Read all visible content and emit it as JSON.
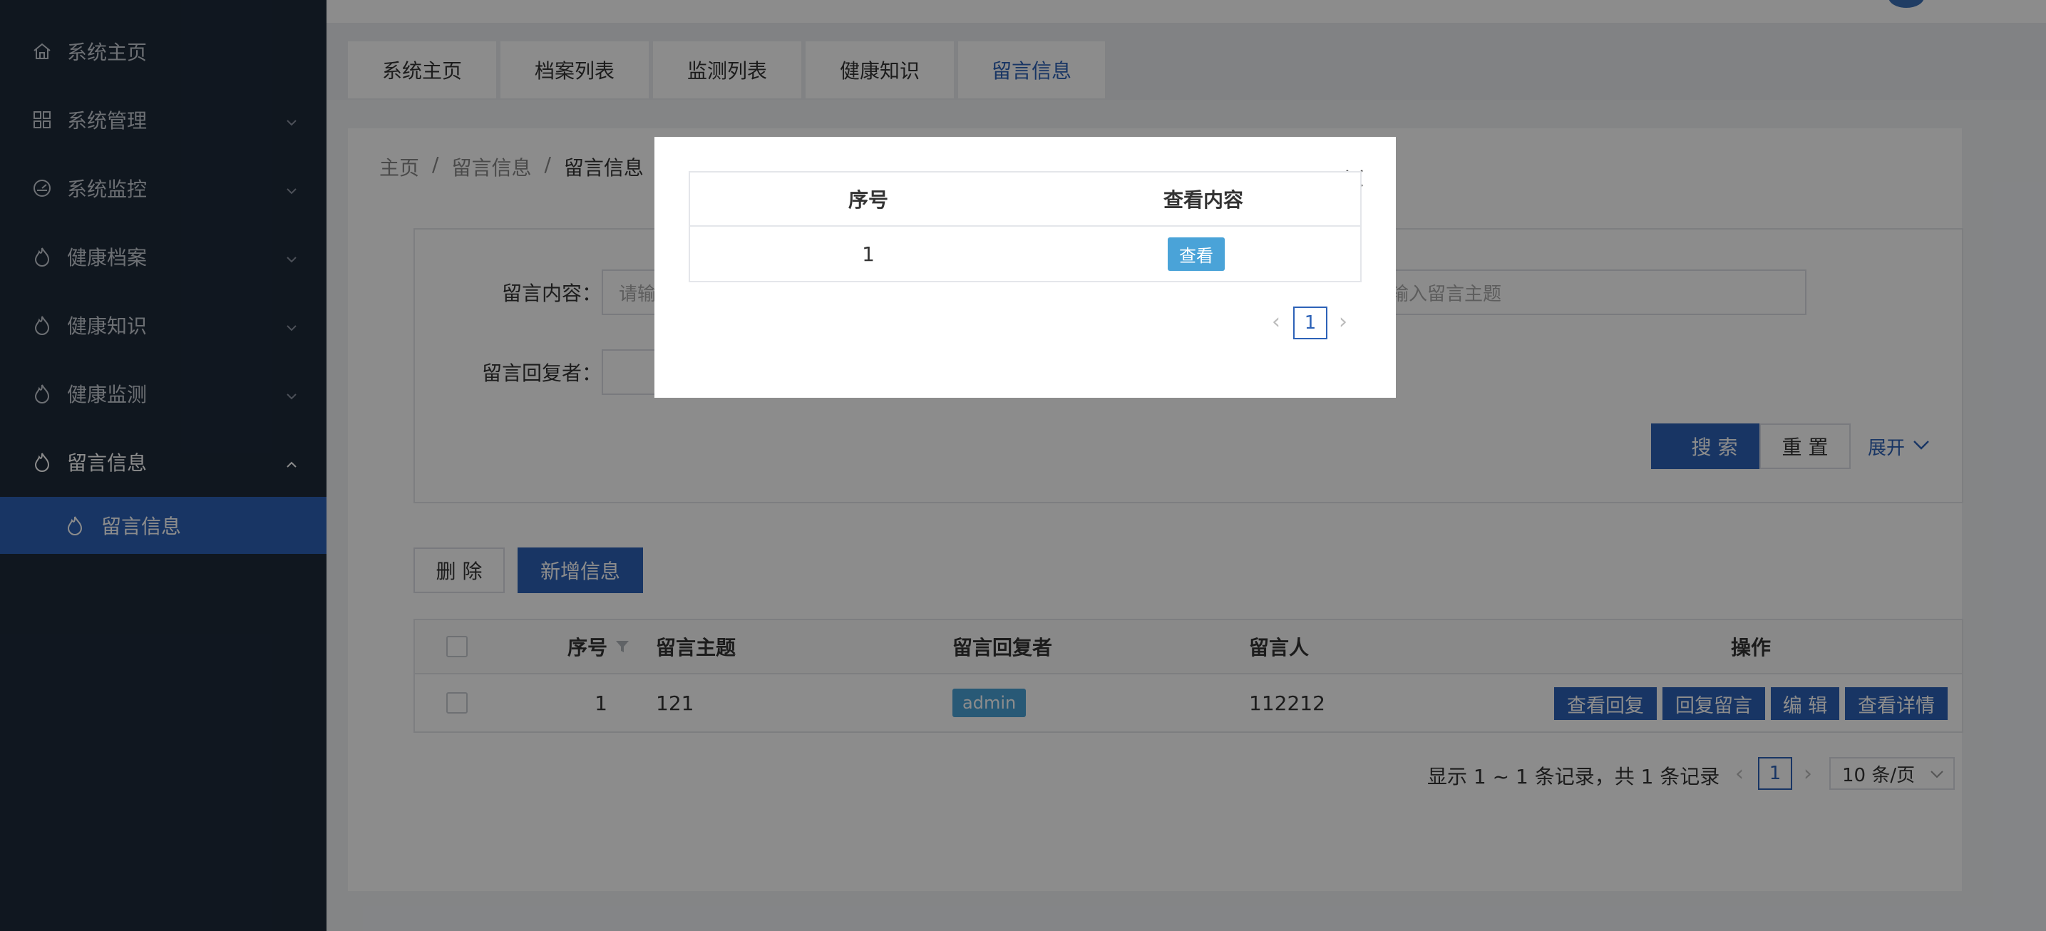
{
  "sidebar": {
    "items": [
      {
        "label": "系统主页",
        "icon": "home-icon"
      },
      {
        "label": "系统管理",
        "icon": "grid-icon"
      },
      {
        "label": "系统监控",
        "icon": "dashboard-icon"
      },
      {
        "label": "健康档案",
        "icon": "flame-icon"
      },
      {
        "label": "健康知识",
        "icon": "flame-icon"
      },
      {
        "label": "健康监测",
        "icon": "flame-icon"
      },
      {
        "label": "留言信息",
        "icon": "flame-icon"
      }
    ],
    "subitem": {
      "label": "留言信息",
      "icon": "flame-icon"
    }
  },
  "tabs": [
    "系统主页",
    "档案列表",
    "监测列表",
    "健康知识",
    "留言信息"
  ],
  "breadcrumb": [
    "主页",
    "/",
    "留言信息",
    "/",
    "留言信息"
  ],
  "search": {
    "content_label": "留言内容：",
    "content_placeholder": "请输入留言内容",
    "topic_placeholder": "请输入留言主题",
    "replier_label": "留言回复者：",
    "search_button": "搜 索",
    "reset_button": "重 置",
    "expand_link": "展开"
  },
  "toolbar": {
    "delete_button": "删 除",
    "add_button": "新增信息"
  },
  "table": {
    "headers": {
      "index": "序号",
      "topic": "留言主题",
      "replier": "留言回复者",
      "author": "留言人",
      "actions": "操作"
    },
    "rows": [
      {
        "index": "1",
        "topic": "121",
        "replier": "admin",
        "author": "112212"
      }
    ],
    "row_actions": [
      "查看回复",
      "回复留言",
      "编 辑",
      "查看详情"
    ]
  },
  "pagination": {
    "summary": "显示 1 ~ 1 条记录，共 1 条记录",
    "current_page": "1",
    "page_size": "10 条/页"
  },
  "modal": {
    "headers": {
      "index": "序号",
      "view": "查看内容"
    },
    "rows": [
      {
        "index": "1",
        "view_button": "查看"
      }
    ],
    "current_page": "1"
  }
}
